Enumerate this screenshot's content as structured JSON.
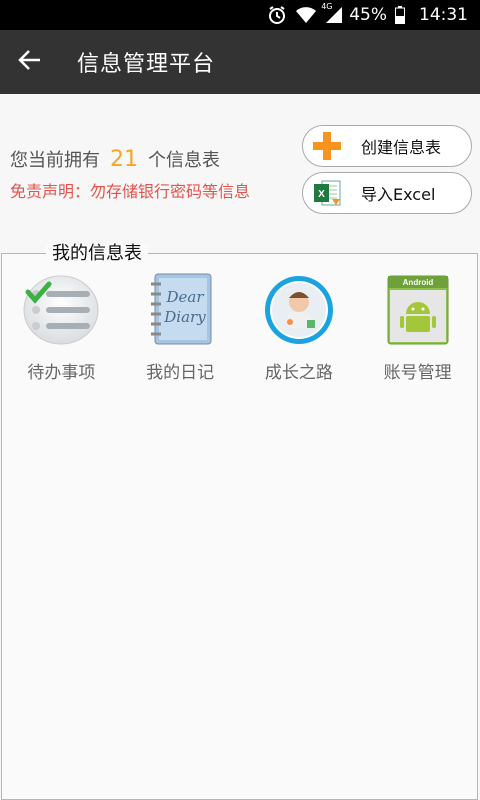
{
  "status_bar": {
    "network": "4G",
    "battery": "45%",
    "time": "14:31",
    "icons": [
      "alarm-icon",
      "wifi-icon",
      "signal-icon",
      "battery-icon"
    ]
  },
  "app_bar": {
    "title": "信息管理平台",
    "back_icon": "arrow-left-icon"
  },
  "summary": {
    "prefix": "您当前拥有",
    "count": "21",
    "suffix": "个信息表",
    "disclaimer": "免责声明：勿存储银行密码等信息"
  },
  "actions": {
    "create_label": "创建信息表",
    "create_icon": "plus-icon",
    "import_label": "导入Excel",
    "import_icon": "excel-icon"
  },
  "tables": {
    "title": "我的信息表",
    "items": [
      {
        "label": "待办事项",
        "icon": "checklist-icon"
      },
      {
        "label": "我的日记",
        "icon": "diary-icon"
      },
      {
        "label": "成长之路",
        "icon": "baby-photo-icon"
      },
      {
        "label": "账号管理",
        "icon": "android-icon",
        "icon_text": "Android"
      }
    ]
  },
  "colors": {
    "status_bar": "#000000",
    "app_bar": "#333333",
    "count_accent": "#f5a623",
    "disclaimer": "#e5534b",
    "panel_border": "#6fd3cf",
    "plus": "#f7941d",
    "excel_green": "#1f7a3f"
  }
}
